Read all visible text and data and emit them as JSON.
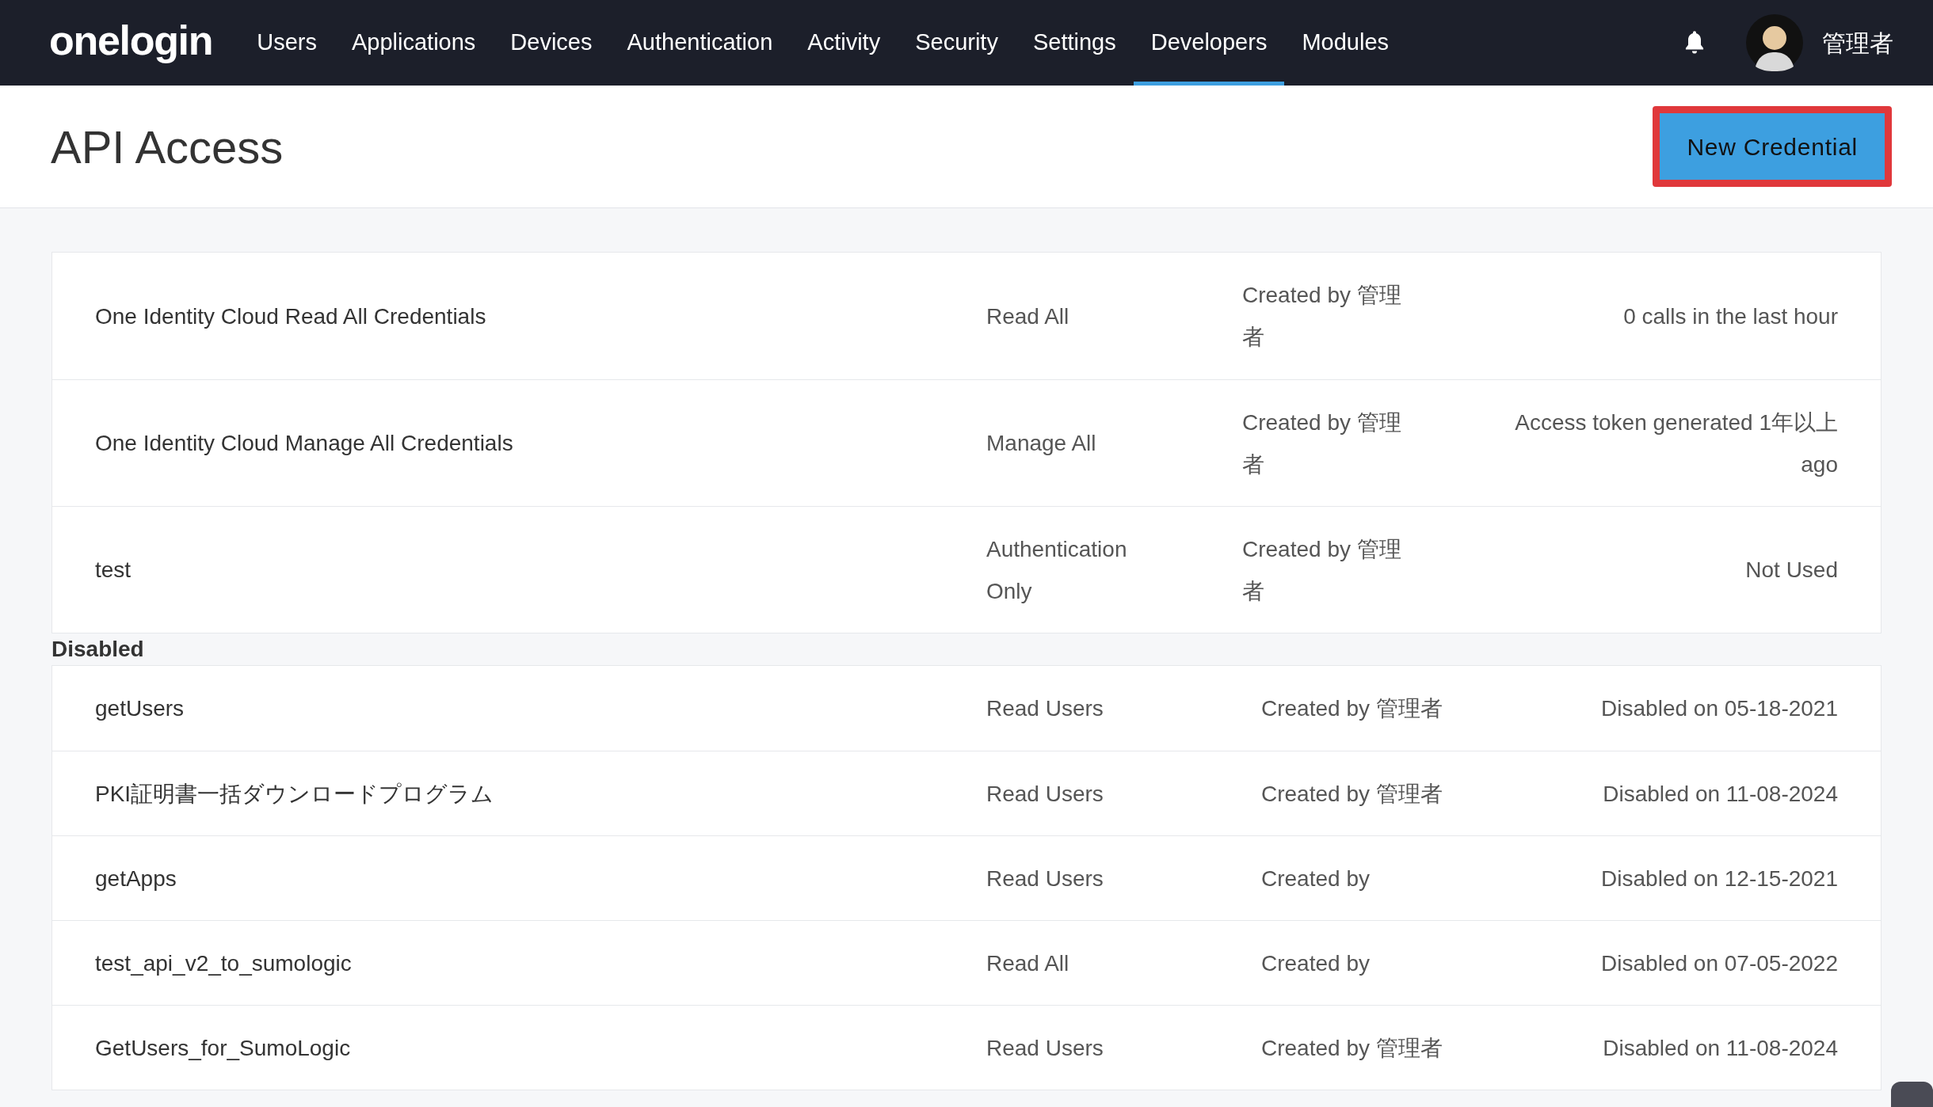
{
  "nav": {
    "logo": "onelogin",
    "items": [
      {
        "label": "Users",
        "selected": false
      },
      {
        "label": "Applications",
        "selected": false
      },
      {
        "label": "Devices",
        "selected": false
      },
      {
        "label": "Authentication",
        "selected": false
      },
      {
        "label": "Activity",
        "selected": false
      },
      {
        "label": "Security",
        "selected": false
      },
      {
        "label": "Settings",
        "selected": false
      },
      {
        "label": "Developers",
        "selected": true
      },
      {
        "label": "Modules",
        "selected": false
      }
    ],
    "user": "管理者"
  },
  "header": {
    "title": "API Access",
    "button": "New Credential"
  },
  "credentials": [
    {
      "name": "One Identity Cloud Read All Credentials",
      "scope": "Read All",
      "created_by": "Created by 管理者",
      "status": "0 calls in the last hour"
    },
    {
      "name": "One Identity Cloud Manage All Credentials",
      "scope": "Manage All",
      "created_by": "Created by 管理者",
      "status": "Access token generated 1年以上 ago"
    },
    {
      "name": "test",
      "scope": "Authentication Only",
      "created_by": "Created by 管理者",
      "status": "Not Used"
    }
  ],
  "disabled": {
    "heading": "Disabled",
    "credentials": [
      {
        "name": "getUsers",
        "scope": "Read Users",
        "created_by": "Created by 管理者",
        "status": "Disabled on 05-18-2021"
      },
      {
        "name": "PKI証明書一括ダウンロードプログラム",
        "scope": "Read Users",
        "created_by": "Created by 管理者",
        "status": "Disabled on 11-08-2024"
      },
      {
        "name": "getApps",
        "scope": "Read Users",
        "created_by": "Created by",
        "status": "Disabled on 12-15-2021"
      },
      {
        "name": "test_api_v2_to_sumologic",
        "scope": "Read All",
        "created_by": "Created by",
        "status": "Disabled on 07-05-2022"
      },
      {
        "name": "GetUsers_for_SumoLogic",
        "scope": "Read Users",
        "created_by": "Created by 管理者",
        "status": "Disabled on 11-08-2024"
      }
    ]
  }
}
